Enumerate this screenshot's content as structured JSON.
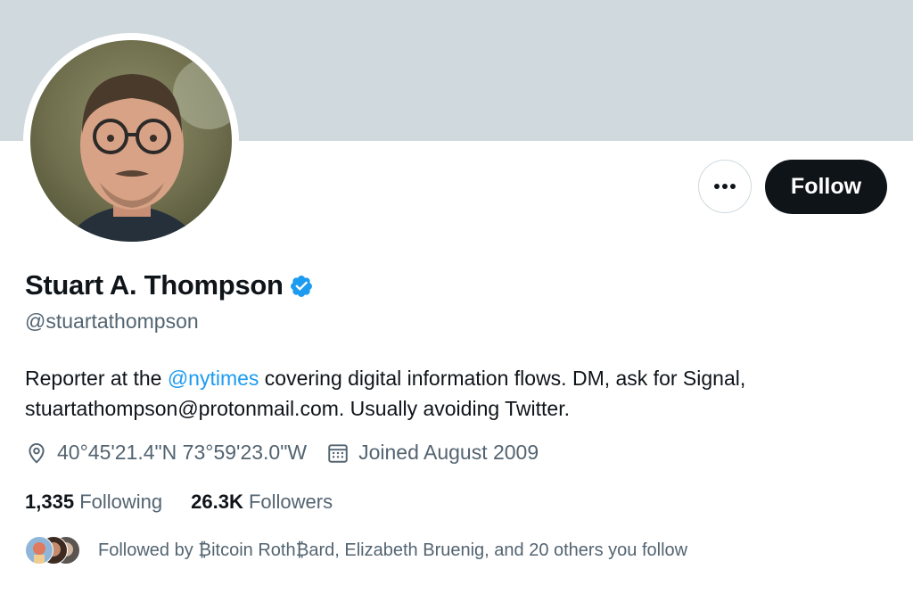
{
  "profile": {
    "name": "Stuart A. Thompson",
    "handle": "@stuartathompson",
    "bio": {
      "before": "Reporter at the ",
      "mention": "@nytimes",
      "after": " covering digital information flows. DM, ask for Signal, stuartathompson@protonmail.com. Usually avoiding Twitter."
    },
    "location": "40°45'21.4\"N 73°59'23.0\"W",
    "joined": "Joined August 2009"
  },
  "actions": {
    "follow_label": "Follow"
  },
  "stats": {
    "following_count": "1,335",
    "following_label": "Following",
    "followers_count": "26.3K",
    "followers_label": "Followers"
  },
  "followed_by": "Followed by ₿itcoin Roth₿ard, Elizabeth Bruenig, and 20 others you follow",
  "icons": {
    "more": "more-horizontal-icon",
    "verified": "verified-badge-icon",
    "location": "location-pin-icon",
    "calendar": "calendar-icon"
  },
  "colors": {
    "banner": "#cfd9de",
    "accent": "#1d9bf0",
    "text": "#0f1419",
    "secondary": "#536471",
    "follow_bg": "#0f1419"
  }
}
